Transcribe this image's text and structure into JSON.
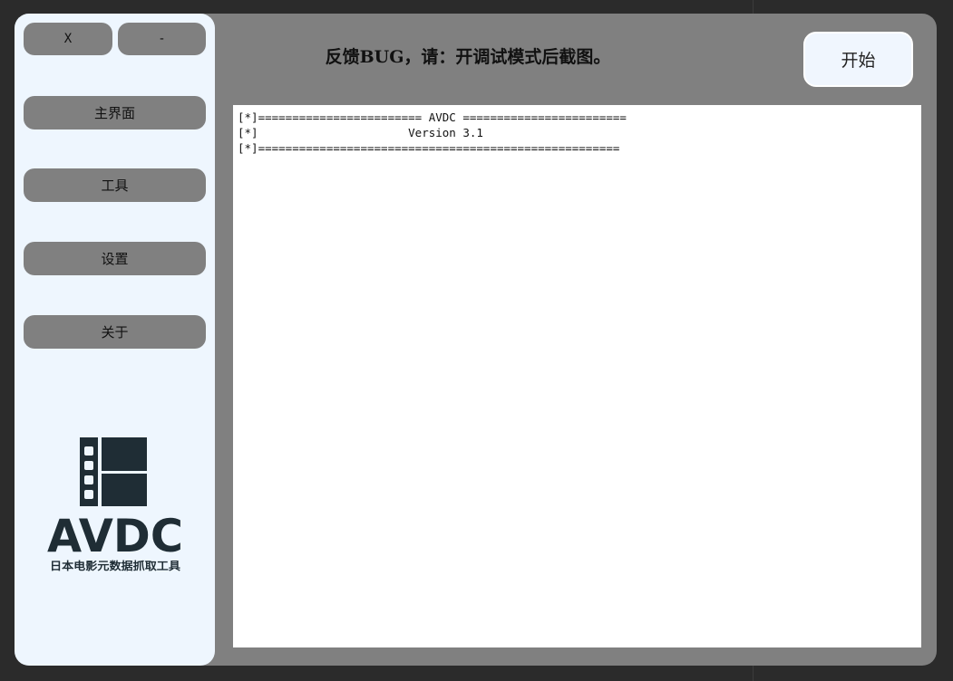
{
  "sidebar": {
    "close_label": "X",
    "minimize_label": "-",
    "items": [
      {
        "label": "主界面"
      },
      {
        "label": "工具"
      },
      {
        "label": "设置"
      },
      {
        "label": "关于"
      }
    ],
    "logo": {
      "title": "AVDC",
      "subtitle": "日本电影元数据抓取工具",
      "icon": "film-strip-icon"
    }
  },
  "main": {
    "feedback_text": "反馈BUG，请：开调试模式后截图。",
    "start_label": "开始",
    "log_lines": [
      "[*]======================== AVDC ========================",
      "[*]                      Version 3.1",
      "[*]====================================================="
    ]
  },
  "colors": {
    "desktop_bg": "#2b2b2b",
    "window_bg": "#808080",
    "sidebar_bg": "#eef6fe",
    "logo_color": "#1f2d35"
  }
}
